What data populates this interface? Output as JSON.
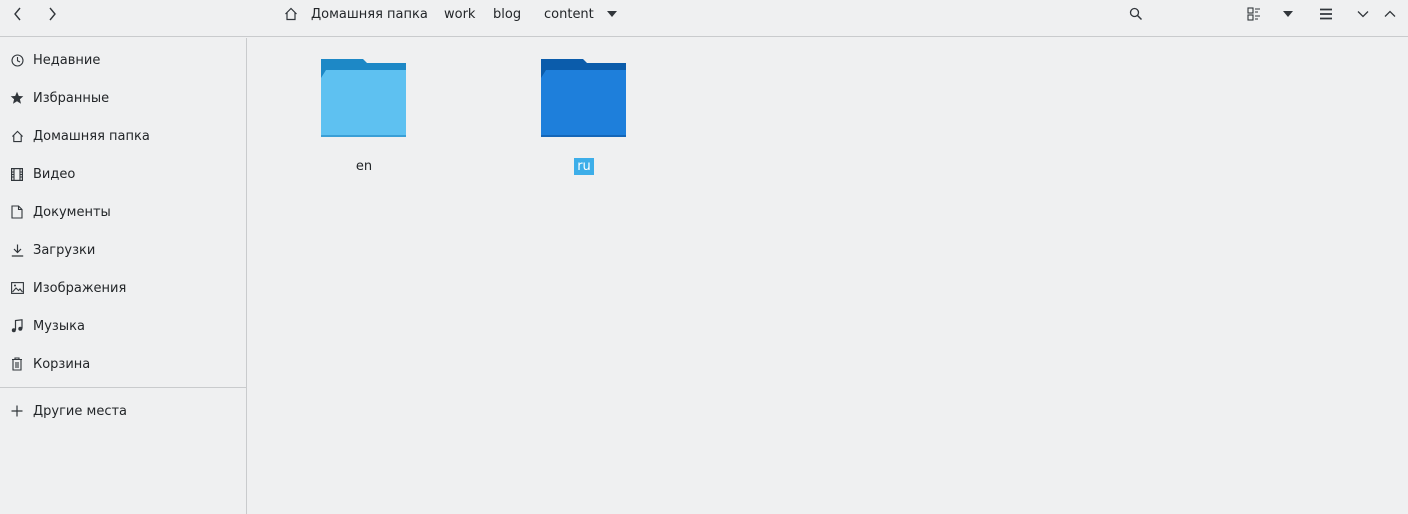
{
  "toolbar": {
    "back_icon": "chevron-left-icon",
    "forward_icon": "chevron-right-icon",
    "breadcrumb": [
      {
        "label": "Домашняя папка",
        "icon": "home-icon"
      },
      {
        "label": "work"
      },
      {
        "label": "blog"
      },
      {
        "label": "content"
      }
    ],
    "search_icon": "search-icon",
    "view_icon": "view-list-icon",
    "menu_icon": "hamburger-menu-icon"
  },
  "sidebar": {
    "items": [
      {
        "label": "Недавние",
        "icon": "clock-icon"
      },
      {
        "label": "Избранные",
        "icon": "star-icon"
      },
      {
        "label": "Домашняя папка",
        "icon": "home-icon"
      },
      {
        "label": "Видео",
        "icon": "film-icon"
      },
      {
        "label": "Документы",
        "icon": "document-icon"
      },
      {
        "label": "Загрузки",
        "icon": "download-icon"
      },
      {
        "label": "Изображения",
        "icon": "image-icon"
      },
      {
        "label": "Музыка",
        "icon": "music-icon"
      },
      {
        "label": "Корзина",
        "icon": "trash-icon"
      }
    ],
    "other_places": {
      "label": "Другие места",
      "icon": "plus-icon"
    }
  },
  "files": [
    {
      "name": "en",
      "color": "#5ec1f1",
      "tab_color": "#1d88c6",
      "selected": false
    },
    {
      "name": "ru",
      "color": "#1e7fdb",
      "tab_color": "#0b5cab",
      "selected": true
    }
  ],
  "colors": {
    "selection": "#3daee9",
    "background": "#eff0f1"
  }
}
